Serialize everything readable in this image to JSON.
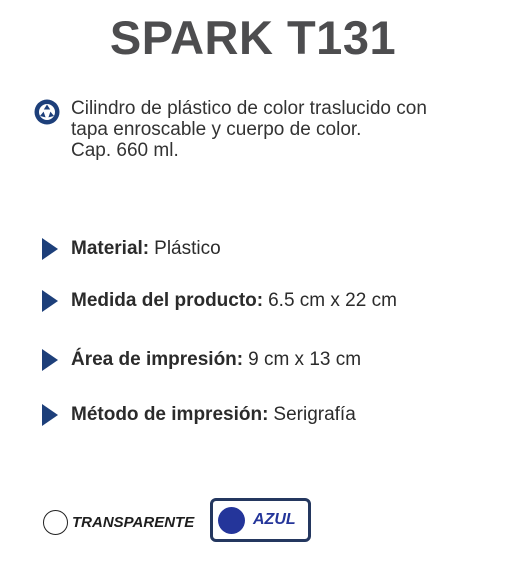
{
  "product": {
    "title": "SPARK T131",
    "description_lines": [
      "Cilindro de plástico de color traslucido con",
      "tapa enroscable y cuerpo de color.",
      "Cap. 660 ml."
    ]
  },
  "specs": [
    {
      "label": "Material:",
      "value": "Plástico"
    },
    {
      "label": "Medida del producto:",
      "value": "6.5 cm x 22 cm"
    },
    {
      "label": "Área de impresión:",
      "value": "9 cm x 13 cm"
    },
    {
      "label": "Método de impresión:",
      "value": "Serigrafía"
    }
  ],
  "colors": [
    {
      "label": "TRANSPARENTE",
      "swatch": "#ffffff",
      "selected": false
    },
    {
      "label": "AZUL",
      "swatch": "#24359a",
      "selected": true
    }
  ],
  "theme": {
    "accent": "#1d3f7a",
    "title_color": "#4d4d4f"
  },
  "icons": {
    "description": "recycle-icon",
    "bullet": "triangle-bullet-icon"
  }
}
